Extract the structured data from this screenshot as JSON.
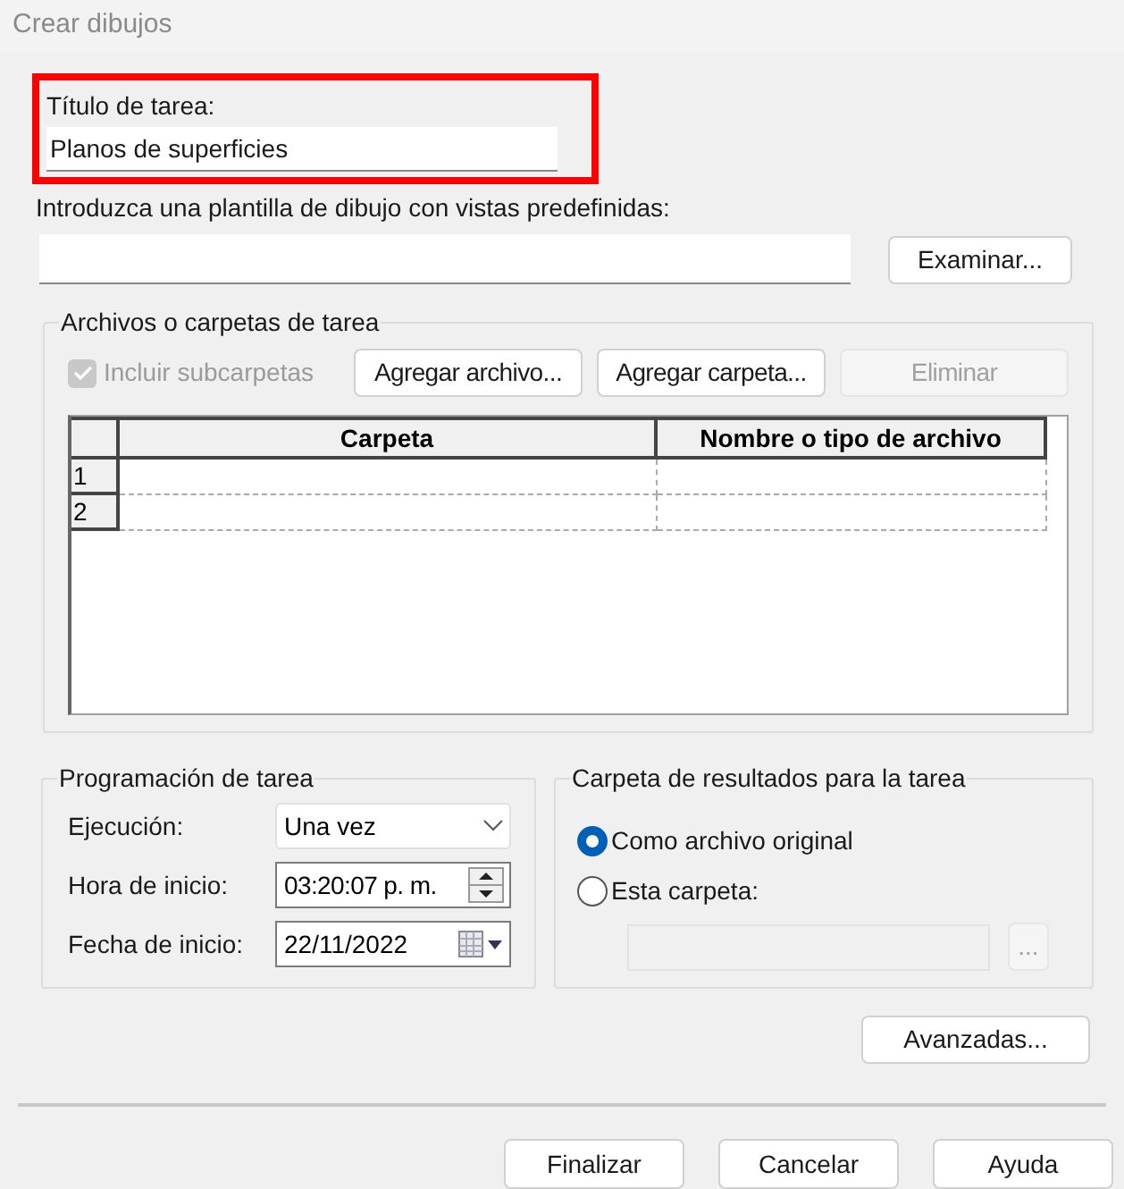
{
  "window": {
    "title": "Crear dibujos"
  },
  "task_title": {
    "label": "Título de tarea:",
    "value": "Planos de superficies",
    "highlighted": true
  },
  "template": {
    "label": "Introduzca una plantilla de dibujo con vistas predefinidas:",
    "browse_button": "Examinar..."
  },
  "files_group": {
    "title": "Archivos o carpetas de tarea",
    "include_subfolders": {
      "label": "Incluir subcarpetas",
      "checked": true,
      "disabled": true
    },
    "buttons": [
      {
        "label": "Agregar archivo...",
        "disabled": false
      },
      {
        "label": "Agregar carpeta...",
        "disabled": false
      },
      {
        "label": "Eliminar",
        "disabled": true
      }
    ],
    "table": {
      "columns": [
        "Carpeta",
        "Nombre o tipo de archivo"
      ],
      "rows": [
        {
          "number": "1"
        },
        {
          "number": "2"
        }
      ]
    }
  },
  "schedule_group": {
    "title": "Programación de tarea",
    "fields": [
      {
        "kind": "dropdown",
        "label": "Ejecución:",
        "value": "Una vez"
      },
      {
        "kind": "spinner",
        "label": "Hora de inicio:",
        "value": "03:20:07 p. m."
      },
      {
        "kind": "date",
        "label": "Fecha de inicio:",
        "value": "22/11/2022"
      }
    ]
  },
  "output_group": {
    "title": "Carpeta de resultados para la tarea",
    "options": [
      {
        "label": "Como archivo original",
        "selected": true
      },
      {
        "label": "Esta carpeta:",
        "selected": false
      }
    ],
    "folder_field": {
      "disabled": true
    },
    "browse_button": {
      "label": "...",
      "disabled": true
    }
  },
  "advanced_button": "Avanzadas...",
  "footer_buttons": [
    "Finalizar",
    "Cancelar",
    "Ayuda"
  ]
}
